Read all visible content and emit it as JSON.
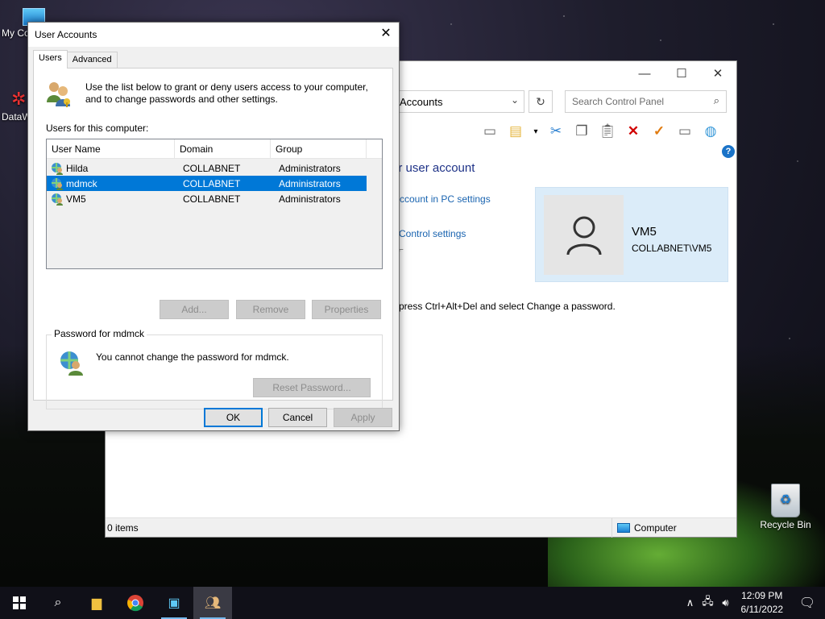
{
  "desktop": {
    "icons": [
      {
        "label": "My Co"
      },
      {
        "label": "DataW"
      },
      {
        "label": "Recycle Bin"
      }
    ]
  },
  "control_panel": {
    "address": "Accounts",
    "search_placeholder": "Search Control Panel",
    "heading": "ur user account",
    "link1": "ccount in PC settings",
    "link2": "Control settings",
    "instruction": "press Ctrl+Alt+Del and select Change a password.",
    "account": {
      "name": "VM5",
      "sub": "COLLABNET\\VM5"
    },
    "status_items": "0 items",
    "status_location": "Computer"
  },
  "dialog": {
    "title": "User Accounts",
    "tabs": [
      "Users",
      "Advanced"
    ],
    "intro": "Use the list below to grant or deny users access to your computer, and to change passwords and other settings.",
    "users_label": "Users for this computer:",
    "columns": [
      "User Name",
      "Domain",
      "Group"
    ],
    "rows": [
      {
        "name": "Hilda",
        "domain": "COLLABNET",
        "group": "Administrators",
        "selected": false
      },
      {
        "name": "mdmck",
        "domain": "COLLABNET",
        "group": "Administrators",
        "selected": true
      },
      {
        "name": "VM5",
        "domain": "COLLABNET",
        "group": "Administrators",
        "selected": false
      }
    ],
    "buttons": {
      "add": "Add...",
      "remove": "Remove",
      "properties": "Properties"
    },
    "password_group": {
      "legend": "Password for mdmck",
      "message": "You cannot change the password for mdmck.",
      "reset": "Reset Password..."
    },
    "footer": {
      "ok": "OK",
      "cancel": "Cancel",
      "apply": "Apply"
    }
  },
  "taskbar": {
    "time": "12:09 PM",
    "date": "6/11/2022"
  }
}
